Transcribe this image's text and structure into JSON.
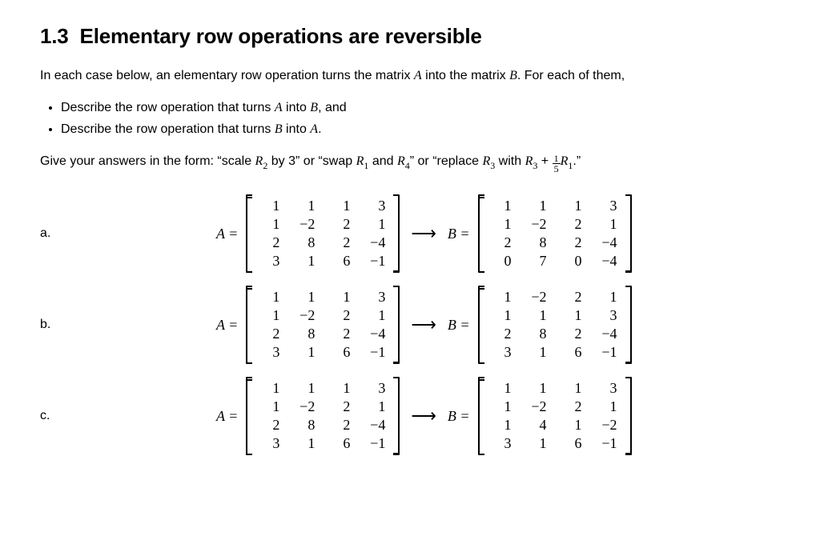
{
  "section": {
    "number": "1.3",
    "title": "Elementary row operations are reversible"
  },
  "intro_before": "In each case below, an elementary row operation turns the matrix ",
  "intro_mid": " into the matrix ",
  "intro_after": ". For each of them,",
  "var_A": "A",
  "var_B": "B",
  "tasks": {
    "t1_a": "Describe the row operation that turns ",
    "t1_b": " into ",
    "t1_c": ", and",
    "t2_a": "Describe the row operation that turns ",
    "t2_b": " into ",
    "t2_c": "."
  },
  "answer_form": {
    "lead": "Give your answers in the form: “scale ",
    "scale_rest": " by 3” or “swap ",
    "swap_mid": " and ",
    "swap_rest": "” or “replace ",
    "replace_mid": " with ",
    "tail": ".”",
    "R2": "R",
    "R2s": "2",
    "R1": "R",
    "R1s": "1",
    "R4": "R",
    "R4s": "4",
    "R3": "R",
    "R3s": "3",
    "plus": " + ",
    "frac_n": "1",
    "frac_d": "5"
  },
  "eq": {
    "Aeq": "A =",
    "Beq": "B =",
    "arrow": "⟶"
  },
  "problems": [
    {
      "label": "a.",
      "A": [
        [
          "1",
          "1",
          "1",
          "3"
        ],
        [
          "1",
          "−2",
          "2",
          "1"
        ],
        [
          "2",
          "8",
          "2",
          "−4"
        ],
        [
          "3",
          "1",
          "6",
          "−1"
        ]
      ],
      "B": [
        [
          "1",
          "1",
          "1",
          "3"
        ],
        [
          "1",
          "−2",
          "2",
          "1"
        ],
        [
          "2",
          "8",
          "2",
          "−4"
        ],
        [
          "0",
          "7",
          "0",
          "−4"
        ]
      ]
    },
    {
      "label": "b.",
      "A": [
        [
          "1",
          "1",
          "1",
          "3"
        ],
        [
          "1",
          "−2",
          "2",
          "1"
        ],
        [
          "2",
          "8",
          "2",
          "−4"
        ],
        [
          "3",
          "1",
          "6",
          "−1"
        ]
      ],
      "B": [
        [
          "1",
          "−2",
          "2",
          "1"
        ],
        [
          "1",
          "1",
          "1",
          "3"
        ],
        [
          "2",
          "8",
          "2",
          "−4"
        ],
        [
          "3",
          "1",
          "6",
          "−1"
        ]
      ]
    },
    {
      "label": "c.",
      "A": [
        [
          "1",
          "1",
          "1",
          "3"
        ],
        [
          "1",
          "−2",
          "2",
          "1"
        ],
        [
          "2",
          "8",
          "2",
          "−4"
        ],
        [
          "3",
          "1",
          "6",
          "−1"
        ]
      ],
      "B": [
        [
          "1",
          "1",
          "1",
          "3"
        ],
        [
          "1",
          "−2",
          "2",
          "1"
        ],
        [
          "1",
          "4",
          "1",
          "−2"
        ],
        [
          "3",
          "1",
          "6",
          "−1"
        ]
      ]
    }
  ]
}
